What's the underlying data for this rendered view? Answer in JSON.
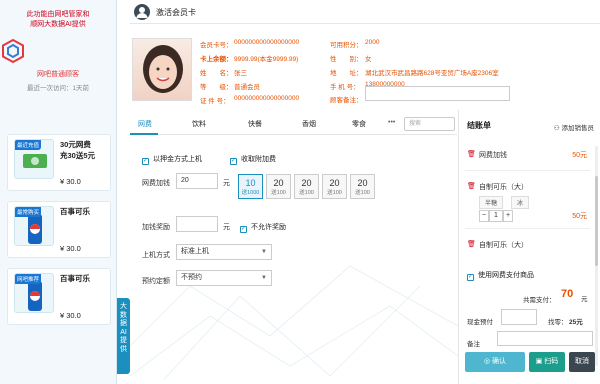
{
  "sidebar": {
    "top_text_line1": "此功能由网吧管家和",
    "top_text_line2": "顺网大数据AI提供",
    "brand": "网吧普通顾客",
    "sub": "最近一次访问：1天前",
    "promos": [
      {
        "tag": "最近充值",
        "title1": "30元网费",
        "title2": "充30送5元",
        "price": "¥ 30.0"
      },
      {
        "tag": "最常购买",
        "title1": "百事可乐",
        "title2": "",
        "price": "¥ 30.0"
      },
      {
        "tag": "网吧推荐",
        "title1": "百事可乐",
        "title2": "",
        "price": "¥ 30.0"
      }
    ],
    "bigdata_tab": "大数据AI提供"
  },
  "header": {
    "title": "激活会员卡"
  },
  "member": {
    "card_no_label": "会员卡号：",
    "card_no": "000000000000000000",
    "balance_label": "卡上余额：",
    "balance": "9999.99(本金9999.99)",
    "name_label": "姓　　名：",
    "name": "张三",
    "level_label": "等　　级：",
    "level": "普通会员",
    "id_label": "证 件 号：",
    "id": "000000000000000000",
    "points_label": "可用积分：",
    "points": "2000",
    "gender_label": "性　　别：",
    "gender": "女",
    "address_label": "地　　址：",
    "address": "湖北武汉市武昌路路628号亚贸广场A座2306室",
    "phone_label": "手 机 号：",
    "phone": "13800000000",
    "remark_label": "顾客备注："
  },
  "tabs": [
    "网费",
    "饮料",
    "快餐",
    "香烟",
    "零食"
  ],
  "tab_more": "•••",
  "search_placeholder": "搜索",
  "form": {
    "chk_mainboard": "以押金方式上机",
    "chk_fee": "收取附加费",
    "fee_label": "网费加钱",
    "fee_value": "20",
    "unit_yuan": "元",
    "amounts": [
      {
        "big": "10",
        "small": "送1000"
      },
      {
        "big": "20",
        "small": "送100"
      },
      {
        "big": "20",
        "small": "送100"
      },
      {
        "big": "20",
        "small": "送100"
      },
      {
        "big": "20",
        "small": "送100"
      }
    ],
    "bonus_label": "加钱奖励",
    "no_bonus": "不允许奖励",
    "mode_label": "上机方式",
    "mode_value": "标准上机",
    "reserve_label": "预约定额",
    "reserve_value": "不预约"
  },
  "checkout": {
    "title": "结账单",
    "add_sales": "添加销售员",
    "items": [
      {
        "name": "网费加钱",
        "price": "50元"
      },
      {
        "name": "自制可乐（大）",
        "tags": [
          "半糖",
          "冰"
        ],
        "qty": "1",
        "price": "50元"
      },
      {
        "name": "自制可乐（大）",
        "price": ""
      }
    ],
    "use_fee": "使用网费支付商品",
    "total_label": "共需支付：",
    "total_value": "70",
    "total_unit": "元",
    "prepay_label": "现金预付",
    "change_label": "找零：",
    "change_value": "25元",
    "remark_label": "备注",
    "confirm": "确认",
    "scan": "扫码",
    "cancel": "取消"
  },
  "colors": {
    "accent": "#1d8fbf",
    "orange": "#e65100",
    "red": "#d0021b"
  }
}
